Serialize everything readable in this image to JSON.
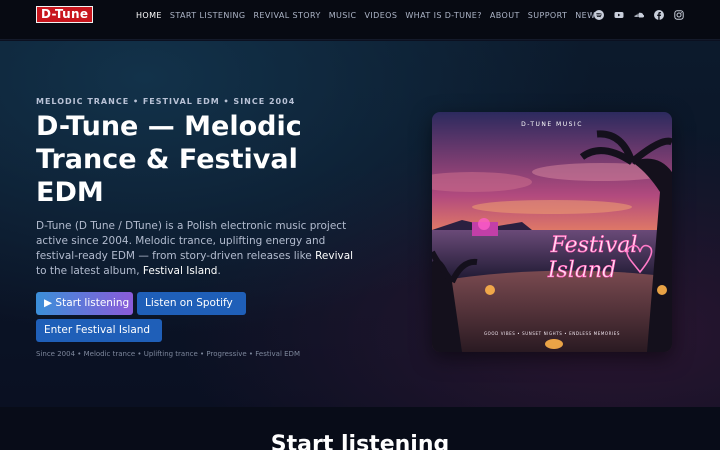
{
  "brand": {
    "logo_text": "D-Tune",
    "logo_color": "#c8161d"
  },
  "nav": {
    "items": [
      {
        "label": "HOME",
        "active": true
      },
      {
        "label": "START LISTENING",
        "active": false
      },
      {
        "label": "REVIVAL STORY",
        "active": false
      },
      {
        "label": "MUSIC",
        "active": false
      },
      {
        "label": "VIDEOS",
        "active": false
      },
      {
        "label": "WHAT IS D-TUNE?",
        "active": false
      },
      {
        "label": "ABOUT",
        "active": false
      },
      {
        "label": "SUPPORT",
        "active": false
      },
      {
        "label": "NEWS",
        "active": false
      }
    ],
    "socials": [
      "spotify-icon",
      "youtube-icon",
      "soundcloud-icon",
      "facebook-icon",
      "instagram-icon"
    ]
  },
  "hero": {
    "kicker": "MELODIC TRANCE • FESTIVAL EDM • SINCE 2004",
    "title": "D-Tune — Melodic Trance & Festival EDM",
    "desc_part1": "D-Tune (D Tune / DTune) is a Polish electronic music project active since 2004. Melodic trance, uplifting energy and festival-ready EDM — from story-driven releases like ",
    "desc_bold1": "Revival",
    "desc_part2": " to the latest album, ",
    "desc_bold2": "Festival Island",
    "desc_part3": ".",
    "buttons": {
      "start": "▶ Start listening",
      "spotify": " Listen on Spotify",
      "festival": " Enter Festival Island"
    },
    "meta": "Since 2004 • Melodic trance • Uplifting trance • Progressive • Festival EDM"
  },
  "album": {
    "label_top": "D-TUNE MUSIC",
    "neon_line1": "Festival",
    "neon_line2": "Island",
    "footer": "GOOD VIBES  •  SUNSET NIGHTS  •  ENDLESS MEMORIES"
  },
  "section": {
    "title": "Start listening"
  },
  "colors": {
    "accent": "#1f5fb8",
    "gradient_start": "#3b8fd9",
    "gradient_end": "#8b5bd9",
    "neon": "#ff4fb0"
  }
}
